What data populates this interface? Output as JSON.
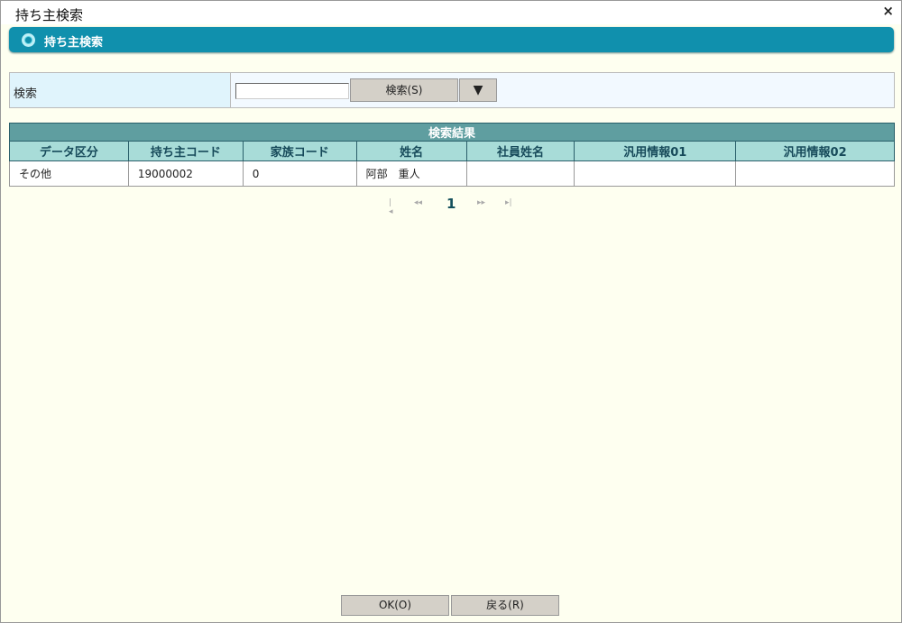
{
  "window": {
    "title": "持ち主検索",
    "close_icon": "×"
  },
  "section": {
    "title": "持ち主検索"
  },
  "search": {
    "label": "検索",
    "value": "",
    "button": "検索(S)",
    "toggle": "▼"
  },
  "results": {
    "caption": "検索結果",
    "columns": [
      "データ区分",
      "持ち主コード",
      "家族コード",
      "姓名",
      "社員姓名",
      "汎用情報01",
      "汎用情報02"
    ],
    "rows": [
      [
        "その他",
        "19000002",
        "0",
        "阿部　重人",
        "",
        "",
        ""
      ]
    ]
  },
  "pager": {
    "first": "|◂",
    "prev": "◂◂",
    "current": "1",
    "next": "▸▸",
    "last": "▸|"
  },
  "footer": {
    "ok": "OK(O)",
    "back": "戻る(R)"
  }
}
